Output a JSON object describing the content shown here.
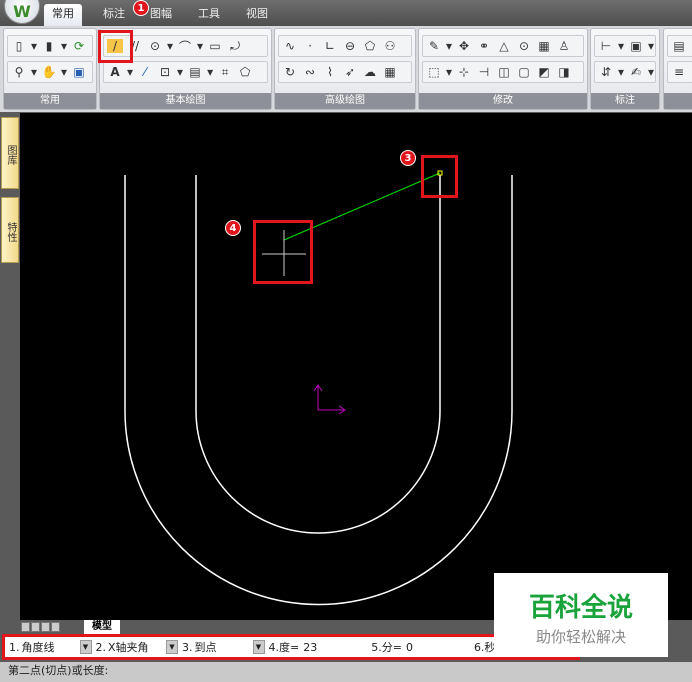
{
  "menu": {
    "tabs": [
      "常用",
      "标注",
      "图幅",
      "工具",
      "视图"
    ],
    "active": 0
  },
  "ribbon": {
    "groups": [
      "常用",
      "基本绘图",
      "高级绘图",
      "修改",
      "标注"
    ]
  },
  "side_tabs": [
    "图库",
    "特性"
  ],
  "drawing_tabs": {
    "model": "模型"
  },
  "command": {
    "f1_label": "1.",
    "f1_value": "角度线",
    "f2_label": "2.",
    "f2_value": "X轴夹角",
    "f3_label": "3.",
    "f3_value": "到点",
    "f4_label": "4.度=",
    "f4_value": "23",
    "f5_label": "5.分=",
    "f5_value": "0",
    "f6_label": "6.秒="
  },
  "status": "第二点(切点)或长度:",
  "markers": [
    "1",
    "3",
    "4"
  ],
  "watermark": {
    "title": "百科全说",
    "subtitle": "助你轻松解决"
  },
  "colors": {
    "accent": "#e0161c",
    "line": "#00e000",
    "ucs": "#c000c0"
  }
}
